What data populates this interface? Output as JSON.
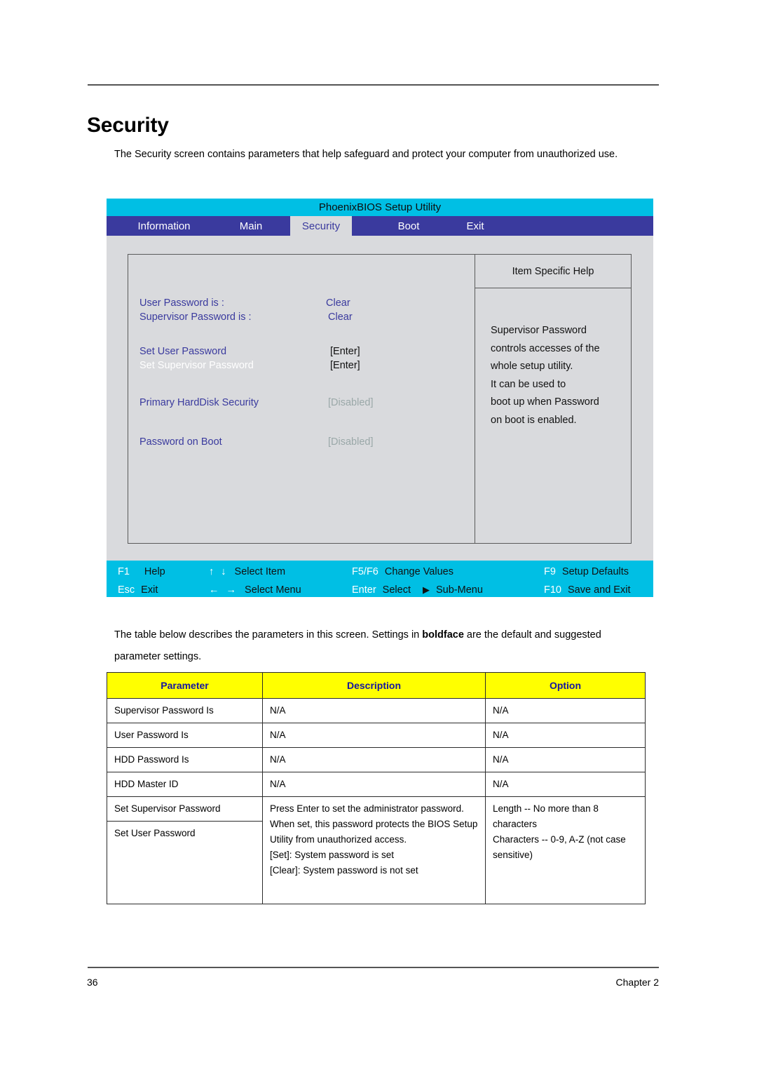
{
  "document": {
    "title": "Security",
    "intro": "The Security screen contains parameters that help safeguard and protect your computer from unauthorized use.",
    "mid_paragraph_before_bold": "The table below describes the parameters in this screen. Settings in ",
    "mid_paragraph_bold": "boldface",
    "mid_paragraph_after_bold": " are the default and suggested  parameter settings.",
    "page_number": "36",
    "chapter": "Chapter 2"
  },
  "bios": {
    "title": "PhoenixBIOS Setup Utility",
    "tabs": [
      {
        "label": "Information",
        "active": false
      },
      {
        "label": "Main",
        "active": false
      },
      {
        "label": "Security",
        "active": true
      },
      {
        "label": "Boot",
        "active": false
      },
      {
        "label": "Exit",
        "active": false
      }
    ],
    "settings": [
      {
        "label": "User Password is :",
        "value": "Clear",
        "state": "normal"
      },
      {
        "label": "Supervisor Password is :",
        "value": "Clear",
        "state": "normal"
      },
      {
        "label": "Set User Password",
        "value": "[Enter]",
        "state": "normal"
      },
      {
        "label": "Set Supervisor Password",
        "value": "[Enter]",
        "state": "selected"
      },
      {
        "label": "Primary HardDisk Security",
        "value": "[Disabled]",
        "state": "normal"
      },
      {
        "label": "Password on Boot",
        "value": "[Disabled]",
        "state": "normal"
      }
    ],
    "help": {
      "title": "Item Specific Help",
      "lines": [
        "Supervisor Password",
        "controls accesses of the",
        "whole setup utility.",
        "It can be used to",
        "boot up when Password",
        "on boot is enabled."
      ]
    },
    "function_keys": [
      {
        "key": "F1",
        "desc": "Help",
        "arrow": ""
      },
      {
        "key": "",
        "desc": "Select Item",
        "arrow": "↑ ↓"
      },
      {
        "key": "F5/F6",
        "desc": "Change Values",
        "arrow": ""
      },
      {
        "key": "F9",
        "desc": "Setup Defaults",
        "arrow": ""
      },
      {
        "key": "Esc",
        "desc": "Exit",
        "arrow": ""
      },
      {
        "key": "",
        "desc": "Select Menu",
        "arrow": "← →"
      },
      {
        "key": "Enter",
        "desc": "Select",
        "arrow": "",
        "extra": "Sub-Menu",
        "triangle": "▶"
      },
      {
        "key": "F10",
        "desc": "Save and Exit",
        "arrow": ""
      }
    ],
    "colors": {
      "titlebar": "#00bfe4",
      "tabbar": "#3a3a9e",
      "panel": "#d9dadd",
      "label": "#3a3a9e",
      "selected_label": "#ffffff",
      "disabled_value": "#9aa8a8"
    }
  },
  "table": {
    "headers": [
      "Parameter",
      "Description",
      "Option"
    ],
    "rows": [
      {
        "parameter": "Supervisor Password Is",
        "description": [
          "N/A"
        ],
        "option": [
          "N/A"
        ]
      },
      {
        "parameter": "User Password Is",
        "description": [
          "N/A"
        ],
        "option": [
          "N/A"
        ]
      },
      {
        "parameter": "HDD Password Is",
        "description": [
          "N/A"
        ],
        "option": [
          "N/A"
        ]
      },
      {
        "parameter": "HDD Master ID",
        "description": [
          "N/A"
        ],
        "option": [
          "N/A"
        ]
      }
    ],
    "merged_row": {
      "parameter_top": "Set Supervisor Password",
      "parameter_bottom": "Set User Password",
      "description_block": "Press Enter to set the administrator password. When set, this password protects the BIOS Setup Utility from unauthorized access.",
      "description_line_set": "[Set]: System password is set",
      "description_line_clear": "[Clear]: System password is not set",
      "option_line1": "Length -- No more than 8 characters",
      "option_line2": "Characters -- 0-9, A-Z (not case sensitive)"
    },
    "header_bg": "#ffff00",
    "header_fg": "#1515a0"
  }
}
